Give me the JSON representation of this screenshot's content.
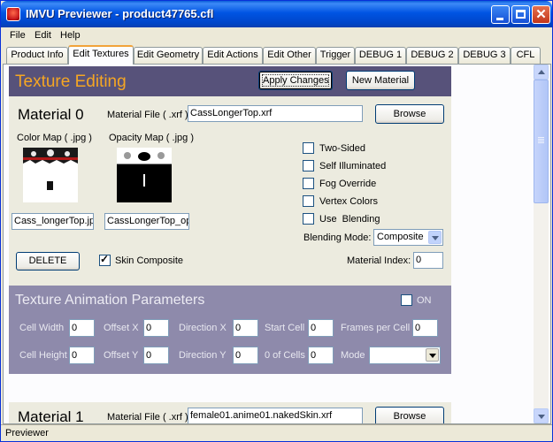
{
  "window": {
    "title": "IMVU Previewer - product47765.cfl"
  },
  "menu": [
    "File",
    "Edit",
    "Help"
  ],
  "tabs": [
    "Product Info",
    "Edit Textures",
    "Edit Geometry",
    "Edit Actions",
    "Edit Other",
    "Trigger",
    "DEBUG 1",
    "DEBUG 2",
    "DEBUG 3",
    "CFL"
  ],
  "active_tab": "Edit Textures",
  "header": {
    "title": "Texture Editing",
    "apply_label": "Apply Changes",
    "new_material_label": "New Material"
  },
  "material0": {
    "title": "Material 0",
    "file_label": "Material File ( .xrf )",
    "file_value": "CassLongerTop.xrf",
    "browse_label": "Browse",
    "color_map_label": "Color Map ( .jpg )",
    "opacity_map_label": "Opacity Map ( .jpg )",
    "color_map_value": "Cass_longerTop.jp",
    "opacity_map_value": "CassLongerTop_op",
    "options": [
      {
        "label": "Two-Sided",
        "checked": false
      },
      {
        "label": "Self Illuminated",
        "checked": false
      },
      {
        "label": "Fog Override",
        "checked": false
      },
      {
        "label": "Vertex Colors",
        "checked": false
      },
      {
        "label": "Use  Blending",
        "checked": false
      }
    ],
    "blending_label": "Blending Mode:",
    "blending_value": "Composite",
    "delete_label": "DELETE",
    "skin_composite_label": "Skin Composite",
    "skin_composite_checked": true,
    "index_label": "Material Index:",
    "index_value": "0"
  },
  "animation": {
    "title": "Texture Animation Parameters",
    "on_label": "ON",
    "on_checked": false,
    "cell_width_label": "Cell Width",
    "cell_width": "0",
    "offset_x_label": "Offset X",
    "offset_x": "0",
    "direction_x_label": "Direction X",
    "direction_x": "0",
    "start_cell_label": "Start Cell",
    "start_cell": "0",
    "frames_per_cell_label": "Frames per Cell",
    "frames_per_cell": "0",
    "cell_height_label": "Cell Height",
    "cell_height": "0",
    "offset_y_label": "Offset Y",
    "offset_y": "0",
    "direction_y_label": "Direction Y",
    "direction_y": "0",
    "num_cells_label": "0 of Cells",
    "num_cells": "0",
    "mode_label": "Mode",
    "mode_value": ""
  },
  "material1": {
    "title": "Material 1",
    "file_label": "Material File ( .xrf )",
    "file_value": "female01.anime01.nakedSkin.xrf",
    "browse_label": "Browse"
  },
  "status": {
    "text": "Previewer"
  },
  "colors": {
    "titlebar": "#0054e3",
    "header_bg": "#57527a",
    "header_title": "#f5a623",
    "anim_bg": "#8e8aab"
  }
}
